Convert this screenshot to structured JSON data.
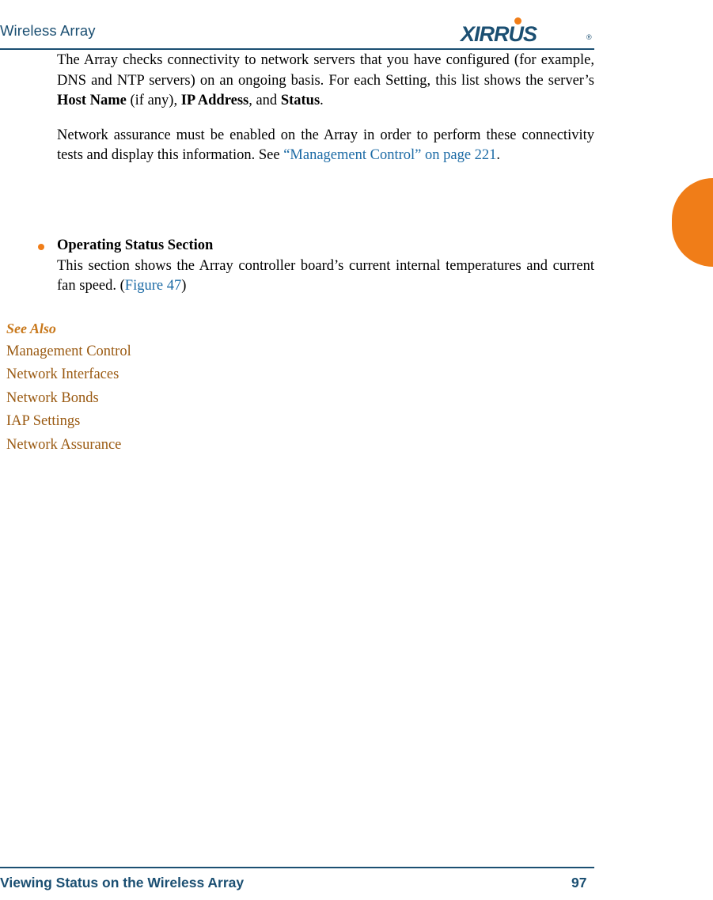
{
  "header": {
    "title": "Wireless Array",
    "logo_text": "XIRRUS",
    "logo_registered": "®"
  },
  "content": {
    "paragraph1": {
      "part1": "The Array checks connectivity to network servers that you have configured (for example, DNS and NTP servers) on an ongoing basis. For each Setting, this list shows the server’s ",
      "bold1": "Host Name",
      "part2": " (if any), ",
      "bold2": "IP Address",
      "part3": ", and ",
      "bold3": "Status",
      "part4": "."
    },
    "paragraph2": {
      "part1": "Network assurance must be enabled on the Array in order to perform these connectivity tests and display this information. See ",
      "link": "“Management Control” on page 221",
      "part2": "."
    },
    "bullet": {
      "heading": "Operating Status Section",
      "body_part1": "This section shows the Array controller board’s current internal temperatures and current fan speed. (",
      "body_link": "Figure 47",
      "body_part2": ")"
    }
  },
  "see_also": {
    "title": "See Also",
    "links": [
      "Management Control",
      "Network Interfaces",
      "Network Bonds",
      "IAP Settings",
      "Network Assurance"
    ]
  },
  "footer": {
    "title": "Viewing Status on the Wireless Array",
    "page_number": "97"
  }
}
